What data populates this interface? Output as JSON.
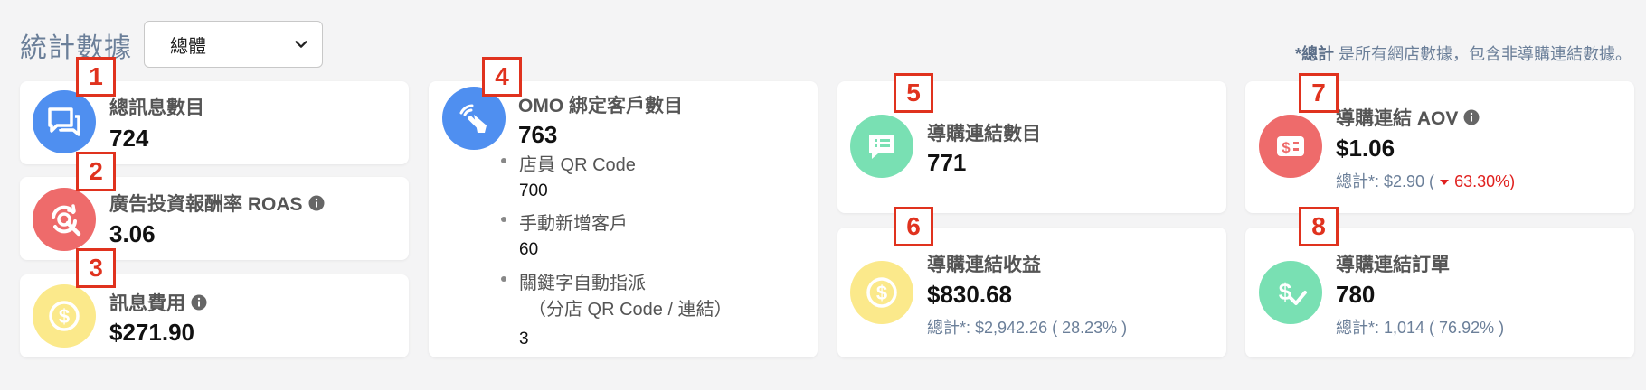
{
  "header": {
    "title": "統計數據",
    "scope_select": {
      "value": "總體"
    },
    "note_bold": "*總計",
    "note_rest": " 是所有網店數據，包含非導購連結數據。"
  },
  "badges": [
    "1",
    "2",
    "3",
    "4",
    "5",
    "6",
    "7",
    "8"
  ],
  "cards": {
    "total_messages": {
      "label": "總訊息數目",
      "value": "724",
      "icon": "chat-bubbles-icon",
      "color": "#4f8ff0"
    },
    "roas": {
      "label": "廣告投資報酬率 ROAS",
      "value": "3.06",
      "icon": "refresh-search-icon",
      "color": "#ee6b6b"
    },
    "message_cost": {
      "label": "訊息費用",
      "value": "$271.90",
      "icon": "dollar-coin-icon",
      "color": "#fbe98b"
    },
    "omo": {
      "label": "OMO 綁定客戶數目",
      "value": "763",
      "icon": "touch-wireless-icon",
      "color": "#4f8ff0",
      "items": [
        {
          "label": "店員 QR Code",
          "value": "700"
        },
        {
          "label": "手動新增客戶",
          "value": "60"
        },
        {
          "label": "關鍵字自動指派",
          "label2": "（分店 QR Code / 連結）",
          "value": "3"
        }
      ]
    },
    "referral_links": {
      "label": "導購連結數目",
      "value": "771",
      "icon": "message-list-icon",
      "color": "#79e0b3"
    },
    "referral_revenue": {
      "label": "導購連結收益",
      "value": "$830.68",
      "sub": "總計*: $2,942.26 ( 28.23% )",
      "icon": "dollar-coin-icon",
      "color": "#fbe98b"
    },
    "referral_aov": {
      "label": "導購連結 AOV",
      "value": "$1.06",
      "sub_prefix": "總計*: $2.90 (",
      "sub_change": "63.30%)",
      "icon": "dollar-bill-icon",
      "color": "#ee6b6b"
    },
    "referral_orders": {
      "label": "導購連結訂單",
      "value": "780",
      "sub": "總計*: 1,014 ( 76.92% )",
      "icon": "dollar-check-icon",
      "color": "#79e0b3"
    }
  }
}
